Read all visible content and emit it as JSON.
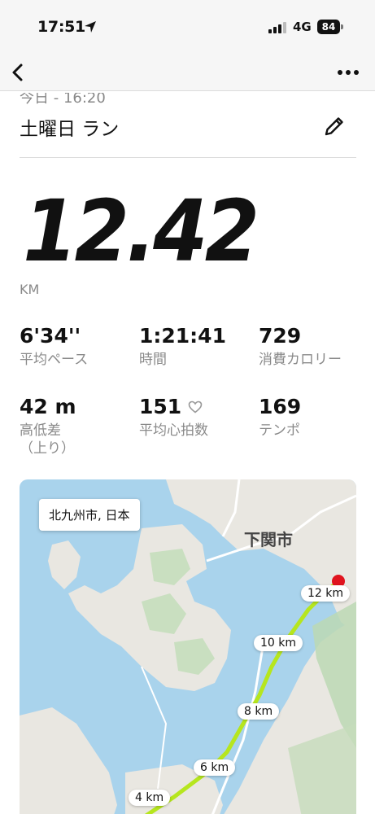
{
  "status_bar": {
    "time": "17:51",
    "network": "4G",
    "battery": "84"
  },
  "activity": {
    "date": "今日 - 16:20",
    "title": "土曜日 ラン",
    "distance": "12.42",
    "distance_unit": "KM"
  },
  "stats": [
    {
      "value": "6'34''",
      "label": "平均ペース"
    },
    {
      "value": "1:21:41",
      "label": "時間"
    },
    {
      "value": "729",
      "label": "消費カロリー"
    },
    {
      "value": "42 m",
      "label": "高低差\n（上り）"
    },
    {
      "value": "151",
      "label": "平均心拍数"
    },
    {
      "value": "169",
      "label": "テンポ"
    }
  ],
  "map": {
    "location": "北九州市, 日本",
    "city_label": "下関市",
    "km_markers": [
      "12 km",
      "10 km",
      "8 km",
      "6 km",
      "4 km"
    ],
    "route_color": "#b6e61e"
  }
}
